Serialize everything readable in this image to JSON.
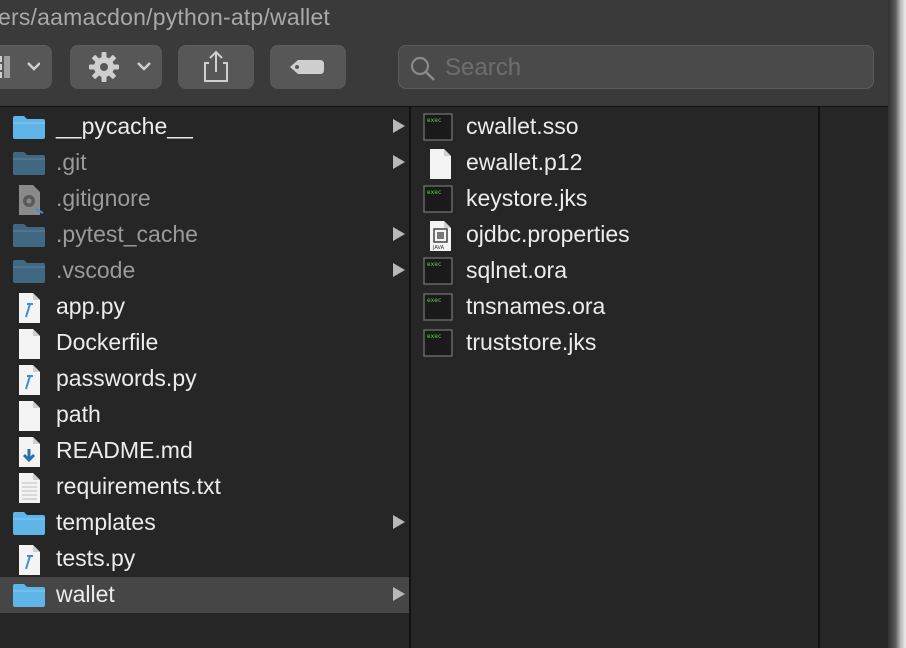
{
  "window": {
    "path_title": "ers/aamacdon/python-atp/wallet"
  },
  "toolbar": {
    "view_icon": "view-options-icon",
    "action_icon": "gear-icon",
    "share_icon": "share-icon",
    "tag_icon": "tag-icon",
    "search_placeholder": "Search",
    "search_value": ""
  },
  "column1": {
    "items": [
      {
        "label": "__pycache__",
        "type": "folder",
        "dim": false,
        "has_children": true,
        "selected": false
      },
      {
        "label": ".git",
        "type": "folder",
        "dim": true,
        "has_children": true,
        "selected": false
      },
      {
        "label": ".gitignore",
        "type": "config-file",
        "dim": true,
        "has_children": false,
        "selected": false
      },
      {
        "label": ".pytest_cache",
        "type": "folder",
        "dim": true,
        "has_children": true,
        "selected": false
      },
      {
        "label": ".vscode",
        "type": "folder",
        "dim": true,
        "has_children": true,
        "selected": false
      },
      {
        "label": "app.py",
        "type": "python-file",
        "dim": false,
        "has_children": false,
        "selected": false
      },
      {
        "label": "Dockerfile",
        "type": "blank-file",
        "dim": false,
        "has_children": false,
        "selected": false
      },
      {
        "label": "passwords.py",
        "type": "python-file",
        "dim": false,
        "has_children": false,
        "selected": false
      },
      {
        "label": "path",
        "type": "blank-file",
        "dim": false,
        "has_children": false,
        "selected": false
      },
      {
        "label": "README.md",
        "type": "markdown-file",
        "dim": false,
        "has_children": false,
        "selected": false
      },
      {
        "label": "requirements.txt",
        "type": "text-file",
        "dim": false,
        "has_children": false,
        "selected": false
      },
      {
        "label": "templates",
        "type": "folder",
        "dim": false,
        "has_children": true,
        "selected": false
      },
      {
        "label": "tests.py",
        "type": "python-file",
        "dim": false,
        "has_children": false,
        "selected": false
      },
      {
        "label": "wallet",
        "type": "folder",
        "dim": false,
        "has_children": true,
        "selected": true
      }
    ]
  },
  "column2": {
    "items": [
      {
        "label": "cwallet.sso",
        "type": "exec-file"
      },
      {
        "label": "ewallet.p12",
        "type": "blank-file"
      },
      {
        "label": "keystore.jks",
        "type": "exec-file"
      },
      {
        "label": "ojdbc.properties",
        "type": "java-file"
      },
      {
        "label": "sqlnet.ora",
        "type": "exec-file"
      },
      {
        "label": "tnsnames.ora",
        "type": "exec-file"
      },
      {
        "label": "truststore.jks",
        "type": "exec-file"
      }
    ]
  },
  "java_badge": "JAVA",
  "colors": {
    "folder": "#5fb4e8",
    "folder_dim": "#4a7fa3",
    "selected_row": "#464646",
    "toolbar_button": "#575757",
    "terminal_text": "#5bd24a"
  }
}
